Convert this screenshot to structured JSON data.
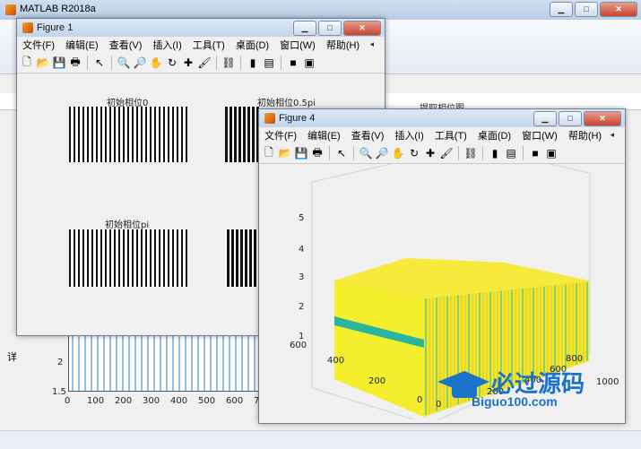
{
  "matlab": {
    "title": "MATLAB R2018a",
    "side_label": "详",
    "plot_title": "提取相位图",
    "yticks": [
      "2",
      "1.5"
    ],
    "xticks": [
      "0",
      "100",
      "200",
      "300",
      "400",
      "500",
      "600",
      "7"
    ]
  },
  "menu": [
    "文件(F)",
    "编辑(E)",
    "查看(V)",
    "插入(I)",
    "工具(T)",
    "桌面(D)",
    "窗口(W)",
    "帮助(H)"
  ],
  "fig1": {
    "title": "Figure 1",
    "labels": [
      "初始相位0",
      "初始相位0.5pi",
      "初始相位pi"
    ]
  },
  "fig4": {
    "title": "Figure 4",
    "zticks": [
      "5",
      "4",
      "3",
      "2",
      "1"
    ],
    "yticks": [
      "600",
      "400",
      "200",
      "0"
    ],
    "xticks": [
      "0",
      "200",
      "400",
      "600",
      "800",
      "1000"
    ]
  },
  "watermark": {
    "brand": "必过源码",
    "url": "Biguo100.com"
  },
  "colors": {
    "title_bg": "#c9daee",
    "yellow": "#f5e925",
    "teal": "#2ab5a0"
  }
}
